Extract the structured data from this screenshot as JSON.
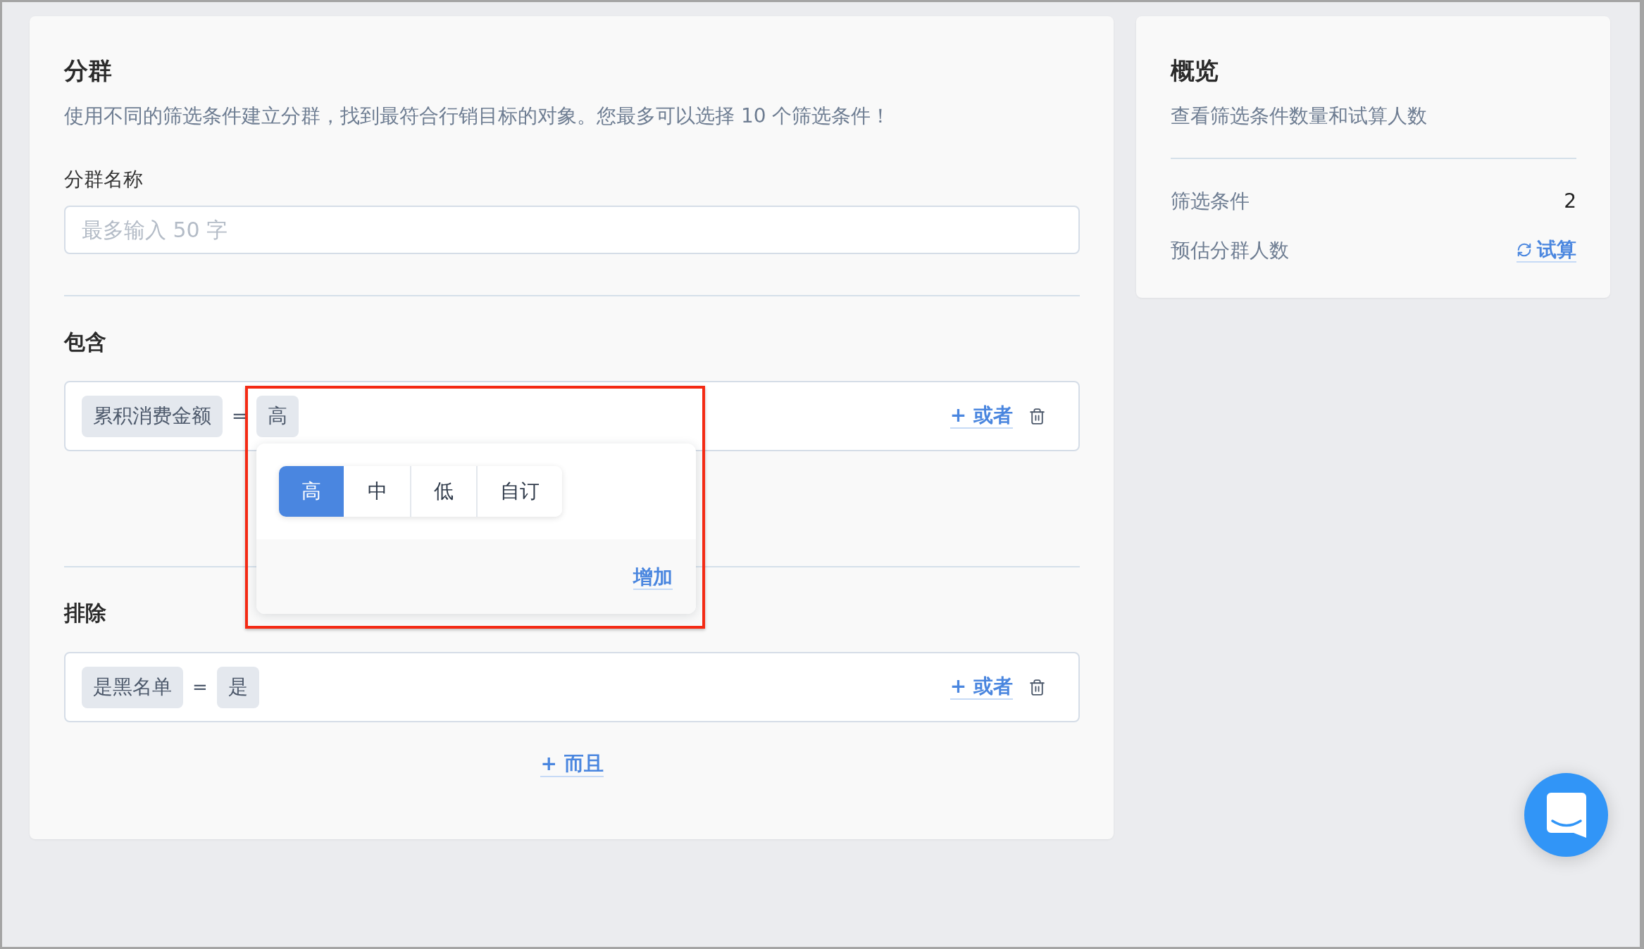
{
  "segment_card": {
    "title": "分群",
    "description": "使用不同的筛选条件建立分群，找到最符合行销目标的对象。您最多可以选择 10 个筛选条件！",
    "name_field": {
      "label": "分群名称",
      "placeholder": "最多输入 50 字"
    },
    "sections": [
      {
        "title": "包含",
        "conditions": [
          {
            "field": "累积消费金额",
            "operator": "=",
            "value": "高",
            "or_link": "+ 或者",
            "value_picker": {
              "highlighted": true,
              "options": [
                {
                  "label": "高",
                  "selected": true
                },
                {
                  "label": "中",
                  "selected": false
                },
                {
                  "label": "低",
                  "selected": false
                },
                {
                  "label": "自订",
                  "selected": false
                }
              ],
              "add_link": "增加"
            }
          }
        ]
      },
      {
        "title": "排除",
        "conditions": [
          {
            "field": "是黑名单",
            "operator": "=",
            "value": "是",
            "or_link": "+ 或者"
          }
        ]
      }
    ],
    "and_link": "+ 而且"
  },
  "overview_card": {
    "title": "概览",
    "description": "查看筛选条件数量和试算人数",
    "rows": [
      {
        "kind": "value",
        "label": "筛选条件",
        "value": "2"
      },
      {
        "kind": "link",
        "label": "预估分群人数",
        "value": "试算"
      }
    ]
  }
}
